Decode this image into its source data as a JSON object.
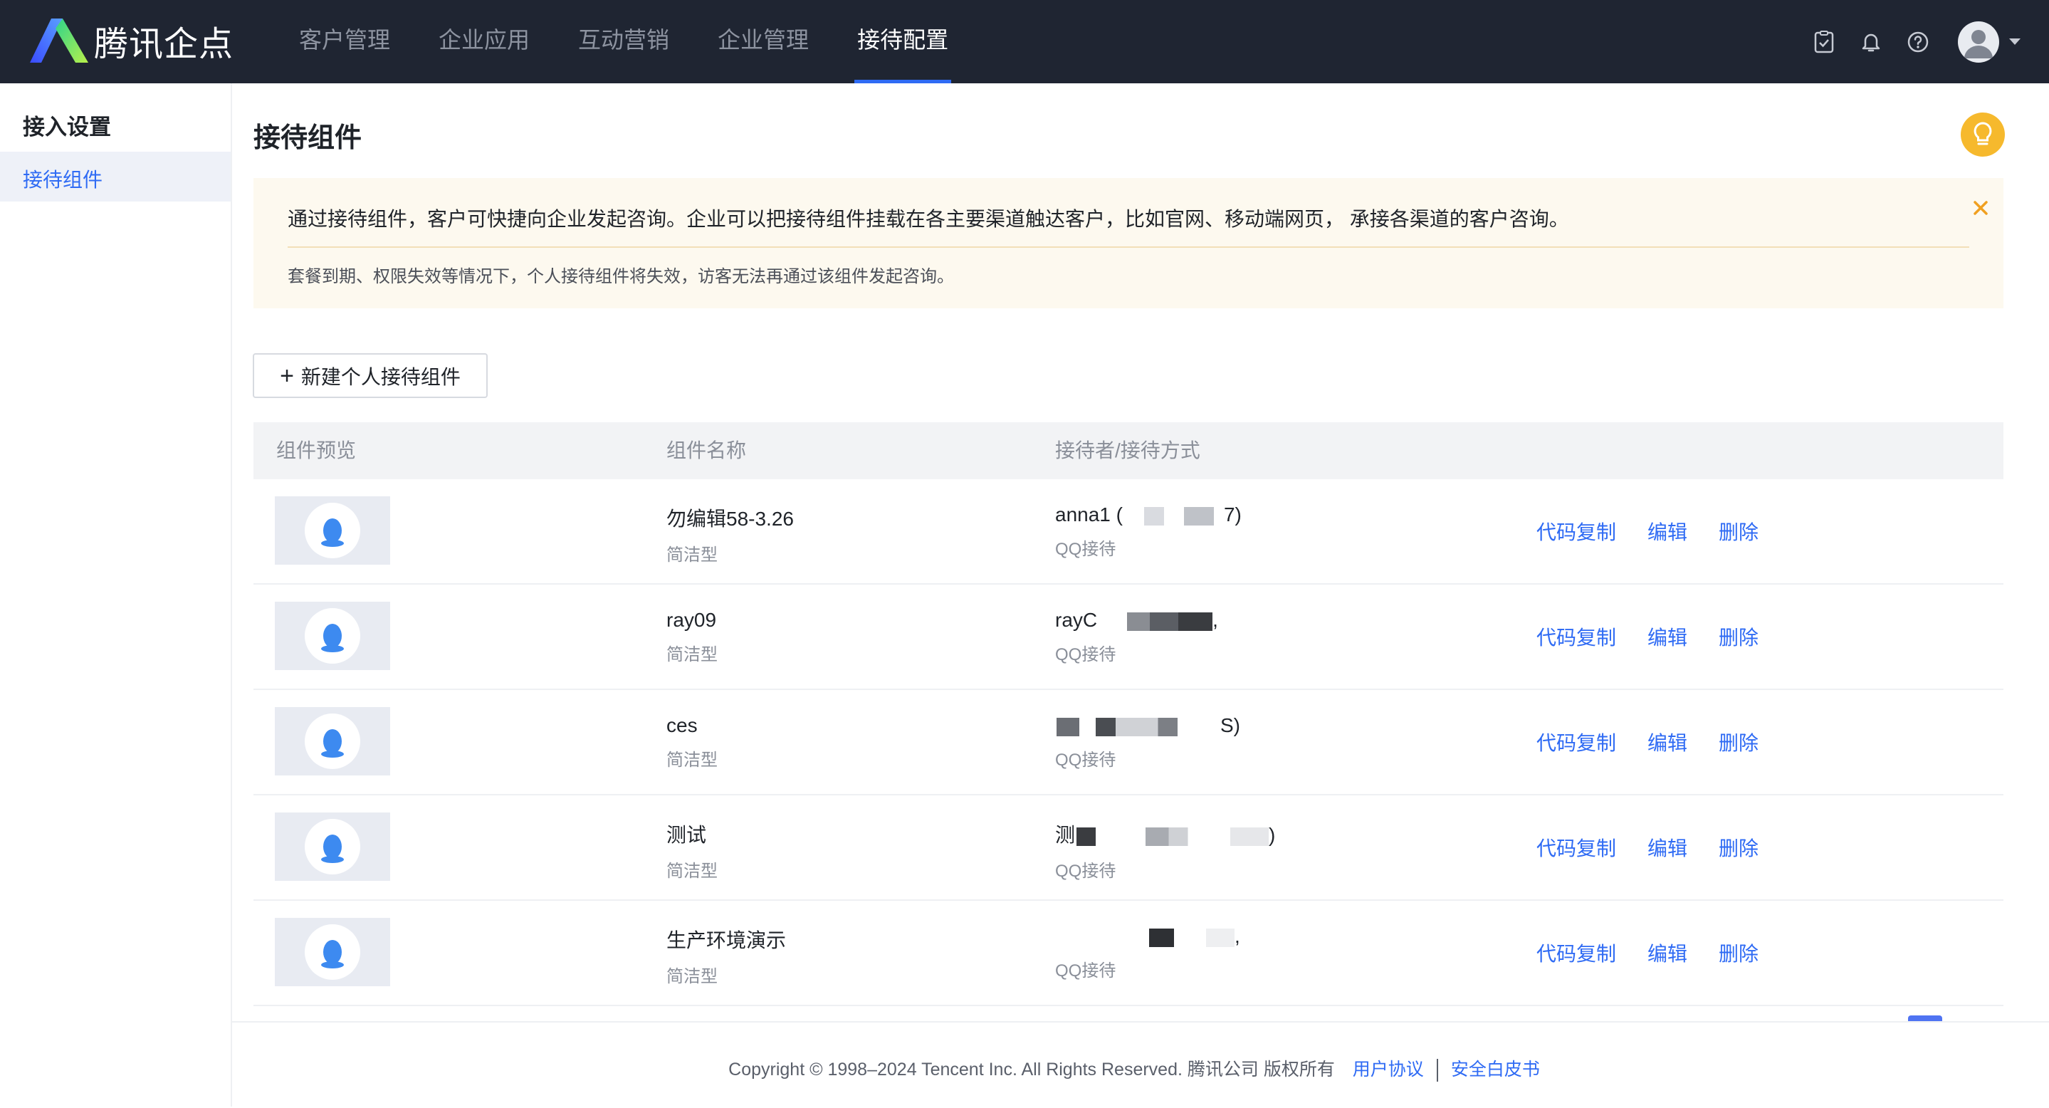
{
  "app": {
    "logo_text": "腾讯企点"
  },
  "nav": {
    "items": [
      {
        "label": "客户管理",
        "active": false
      },
      {
        "label": "企业应用",
        "active": false
      },
      {
        "label": "互动营销",
        "active": false
      },
      {
        "label": "企业管理",
        "active": false
      },
      {
        "label": "接待配置",
        "active": true
      }
    ]
  },
  "top_icons": [
    "checklist-icon",
    "bell-icon",
    "help-icon",
    "avatar"
  ],
  "sidebar": {
    "title": "接入设置",
    "items": [
      {
        "label": "接待组件",
        "active": true
      }
    ]
  },
  "page": {
    "title": "接待组件"
  },
  "notice": {
    "main": "通过接待组件，客户可快捷向企业发起咨询。企业可以把接待组件挂载在各主要渠道触达客户，比如官网、移动端网页， 承接各渠道的客户咨询。",
    "sub": "套餐到期、权限失效等情况下，个人接待组件将失效，访客无法再通过该组件发起咨询。"
  },
  "new_button": {
    "label": "新建个人接待组件"
  },
  "table": {
    "headers": [
      "组件预览",
      "组件名称",
      "接待者/接待方式"
    ],
    "rows": [
      {
        "name": "勿编辑58-3.26",
        "type": "简洁型",
        "receiver_prefix": "anna1 (",
        "receiver_suffix": "7)",
        "method": "QQ接待"
      },
      {
        "name": "ray09",
        "type": "简洁型",
        "receiver_prefix": "rayC",
        "receiver_suffix": ",",
        "method": "QQ接待"
      },
      {
        "name": "ces",
        "type": "简洁型",
        "receiver_prefix": "",
        "receiver_suffix": "S)",
        "method": "QQ接待"
      },
      {
        "name": "测试",
        "type": "简洁型",
        "receiver_prefix": "测",
        "receiver_suffix": ")",
        "method": "QQ接待"
      },
      {
        "name": "生产环境演示",
        "type": "简洁型",
        "receiver_prefix": "",
        "receiver_suffix": ",",
        "method": "QQ接待"
      }
    ],
    "actions": {
      "copy": "代码复制",
      "edit": "编辑",
      "delete": "删除"
    }
  },
  "footer": {
    "copyright": "Copyright © 1998–2024 Tencent Inc. All Rights Reserved. 腾讯公司 版权所有",
    "link1": "用户协议",
    "link2": "安全白皮书"
  },
  "colors": {
    "accent": "#2f6bf4",
    "topbar": "#1f2532",
    "notice_bg": "#fdf9ef",
    "bulb": "#f6b92d"
  }
}
